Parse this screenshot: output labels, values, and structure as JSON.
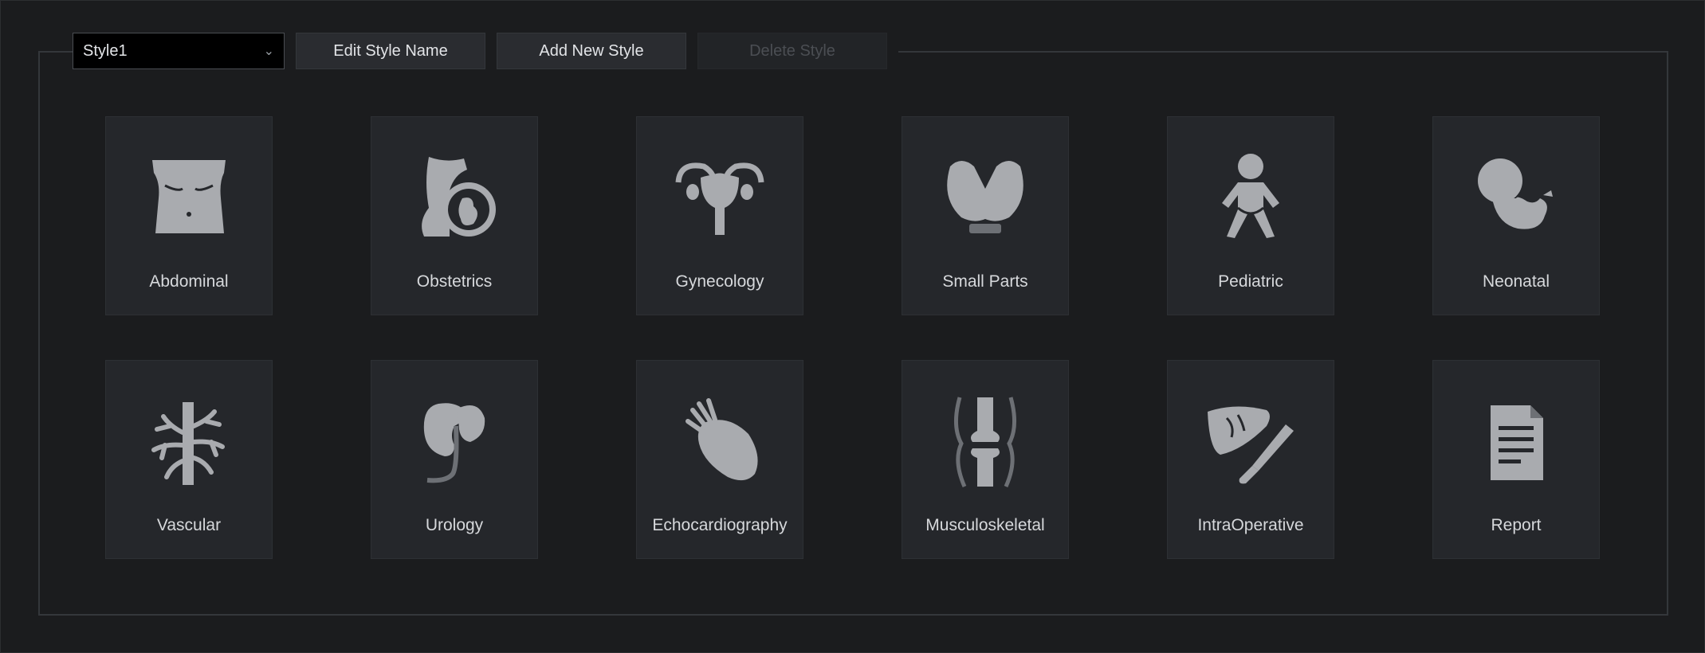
{
  "toolbar": {
    "style_select_value": "Style1",
    "edit_style_name": "Edit Style Name",
    "add_new_style": "Add New Style",
    "delete_style": "Delete Style"
  },
  "icon_color": "#a9abaf",
  "tiles": [
    {
      "label": "Abdominal",
      "icon": "abdomen-icon"
    },
    {
      "label": "Obstetrics",
      "icon": "pregnancy-icon"
    },
    {
      "label": "Gynecology",
      "icon": "uterus-icon"
    },
    {
      "label": "Small Parts",
      "icon": "thyroid-icon"
    },
    {
      "label": "Pediatric",
      "icon": "child-icon"
    },
    {
      "label": "Neonatal",
      "icon": "fetus-icon"
    },
    {
      "label": "Vascular",
      "icon": "vessels-icon"
    },
    {
      "label": "Urology",
      "icon": "kidney-icon"
    },
    {
      "label": "Echocardiography",
      "icon": "heart-icon"
    },
    {
      "label": "Musculoskeletal",
      "icon": "knee-joint-icon"
    },
    {
      "label": "IntraOperative",
      "icon": "liver-scalpel-icon"
    },
    {
      "label": "Report",
      "icon": "document-icon"
    }
  ]
}
